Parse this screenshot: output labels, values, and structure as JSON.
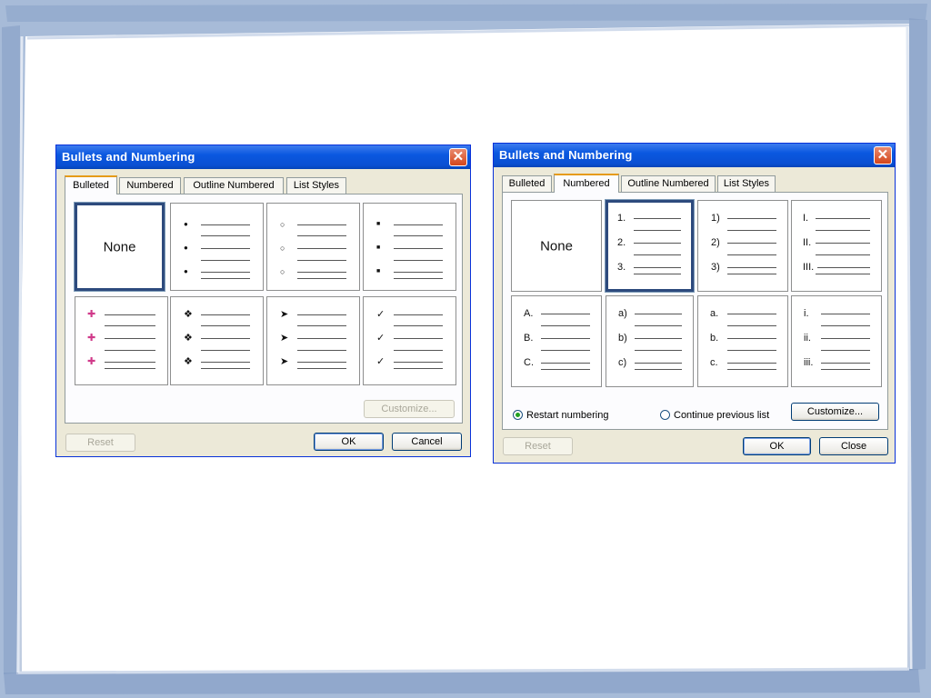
{
  "left_dialog": {
    "title": "Bullets and Numbering",
    "close_glyph": "✕",
    "tabs": [
      "Bulleted",
      "Numbered",
      "Outline Numbered",
      "List Styles"
    ],
    "active_tab": "Bulleted",
    "none_label": "None",
    "customize_label": "Customize...",
    "reset_label": "Reset",
    "ok_label": "OK",
    "cancel_label": "Cancel",
    "bullet_styles": [
      {
        "icon": "filled-dot-icon",
        "glyph": "●"
      },
      {
        "icon": "hollow-circle-icon",
        "glyph": "○"
      },
      {
        "icon": "square-icon",
        "glyph": "■"
      },
      {
        "icon": "picture-bullet-icon",
        "glyph": "✚"
      },
      {
        "icon": "four-diamond-icon",
        "glyph": "❖"
      },
      {
        "icon": "arrowhead-icon",
        "glyph": "➤"
      },
      {
        "icon": "checkmark-icon",
        "glyph": "✓"
      }
    ]
  },
  "right_dialog": {
    "title": "Bullets and Numbering",
    "close_glyph": "✕",
    "tabs": [
      "Bulleted",
      "Numbered",
      "Outline Numbered",
      "List Styles"
    ],
    "active_tab": "Numbered",
    "none_label": "None",
    "number_styles": [
      [
        "1.",
        "2.",
        "3."
      ],
      [
        "1)",
        "2)",
        "3)"
      ],
      [
        "I.",
        "II.",
        "III."
      ],
      [
        "A.",
        "B.",
        "C."
      ],
      [
        "a)",
        "b)",
        "c)"
      ],
      [
        "a.",
        "b.",
        "c."
      ],
      [
        "i.",
        "ii.",
        "iii."
      ]
    ],
    "selected_style": "1.",
    "restart_label": "Restart numbering",
    "continue_label": "Continue previous list",
    "restart_selected": true,
    "customize_label": "Customize...",
    "reset_label": "Reset",
    "ok_label": "OK",
    "close_label": "Close"
  },
  "colors": {
    "title_bar": "#0a58e0",
    "dialog_face": "#ece9d8",
    "frame_blue": "#a8bcd9"
  }
}
